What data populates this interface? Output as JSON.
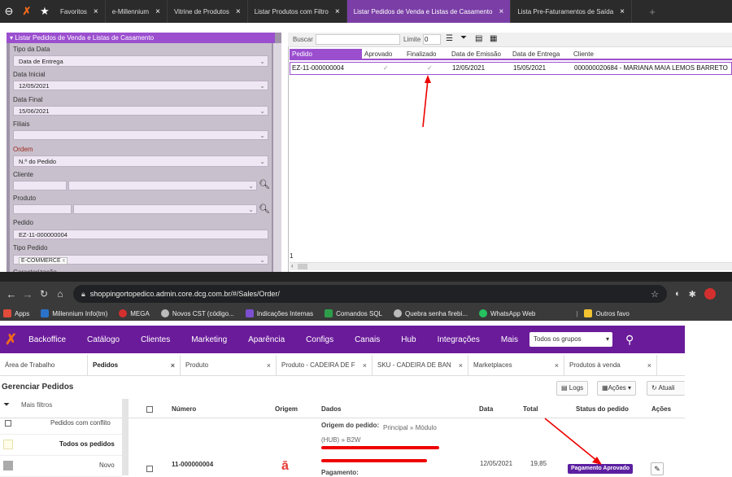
{
  "top_tabs": [
    {
      "label": "Favoritos",
      "close": "×"
    },
    {
      "label": "e-Millennium",
      "close": "×"
    },
    {
      "label": "Vitrine de Produtos",
      "close": "×"
    },
    {
      "label": "Listar Produtos com Filtro",
      "close": "×"
    },
    {
      "label": "Listar Pedidos de Venda e Listas de Casamento",
      "close": "×"
    },
    {
      "label": "Lista Pre-Faturamentos de Saída",
      "close": "×"
    }
  ],
  "left_panel": {
    "title": "▾ Listar Pedidos de Venda e Listas de Casamento",
    "tipo_data_label": "Tipo da Data",
    "tipo_data_value": "Data de Entrega",
    "data_inicial_label": "Data Inicial",
    "data_inicial_value": "12/05/2021",
    "data_final_label": "Data Final",
    "data_final_value": "15/06/2021",
    "filiais_label": "Filiais",
    "ordem_label": "Ordem",
    "ordem_value": "N.º do Pedido",
    "cliente_label": "Cliente",
    "produto_label": "Produto",
    "pedido_label": "Pedido",
    "pedido_value": "EZ-11-000000004",
    "tipo_pedido_label": "Tipo Pedido",
    "tipo_pedido_value": "E-COMMERCE",
    "tipo_pedido_x": "x",
    "cut_label": "Caracterização"
  },
  "right_panel": {
    "buscar": "Buscar",
    "limite_label": "Limite",
    "limite_value": "0",
    "headers": [
      "Pedido",
      "Aprovado",
      "Finalizado",
      "Data de Emissão",
      "Data de Entrega",
      "Cliente"
    ],
    "row": {
      "pedido": "EZ-11-000000004",
      "aprovado": "✓",
      "finalizado": "✓",
      "emissao": "12/05/2021",
      "entrega": "15/05/2021",
      "cliente": "000000020684 - MARIANA MAIA LEMOS BARRETO"
    },
    "count": "1"
  },
  "browser": {
    "url": "shoppingortopedico.admin.core.dcg.com.br/#/Sales/Order/"
  },
  "bookmarks": [
    {
      "label": "Apps",
      "color": "#e04b3a"
    },
    {
      "label": "Millennium Info(tm)",
      "color": "#2a73c9"
    },
    {
      "label": "MEGA",
      "color": "#d32f2f"
    },
    {
      "label": "Novos CST (código...",
      "color": "#bbbbbb"
    },
    {
      "label": "Indicações Internas",
      "color": "#7b4fd0"
    },
    {
      "label": "Comandos SQL",
      "color": "#2e9d4a"
    },
    {
      "label": "Quebra senha firebi...",
      "color": "#bbbbbb"
    },
    {
      "label": "WhatsApp Web",
      "color": "#25c05f"
    },
    {
      "label": "Outros favo",
      "color": "#f2c230"
    }
  ],
  "nav": {
    "items": [
      "Backoffice",
      "Catálogo",
      "Clientes",
      "Marketing",
      "Aparência",
      "Configs",
      "Canais",
      "Hub",
      "Integrações",
      "Mais"
    ],
    "group_select": "Todos os grupos"
  },
  "tabs2": [
    {
      "label": "Área de Trabalho",
      "close": ""
    },
    {
      "label": "Pedidos",
      "close": "×"
    },
    {
      "label": "Produto",
      "close": "×"
    },
    {
      "label": "Produto - CADEIRA DE F",
      "close": "×"
    },
    {
      "label": "SKU - CADEIRA DE BAN",
      "close": "×"
    },
    {
      "label": "Marketplaces",
      "close": "×"
    },
    {
      "label": "Produtos à venda",
      "close": "×"
    }
  ],
  "manager": {
    "title": "Gerenciar Pedidos",
    "logs": "Logs",
    "acoes": "Ações",
    "atualizar": "Atuali"
  },
  "filters": {
    "mais": "Mais filtros",
    "items": [
      "Pedidos com conflito",
      "Todos os pedidos",
      "Novo"
    ]
  },
  "grid": {
    "headers": [
      "Número",
      "Origem",
      "Dados",
      "Data",
      "Total",
      "Status do pedido",
      "Ações"
    ],
    "row": {
      "numero": "11-000000004",
      "origem_line": "Origem do pedido:",
      "origem_val": "Principal » Módulo (HUB) » B2W",
      "data": "12/05/2021",
      "total": "19,85",
      "status": "Pagamento Aprovado",
      "pagamento": "Pagamento:"
    }
  }
}
